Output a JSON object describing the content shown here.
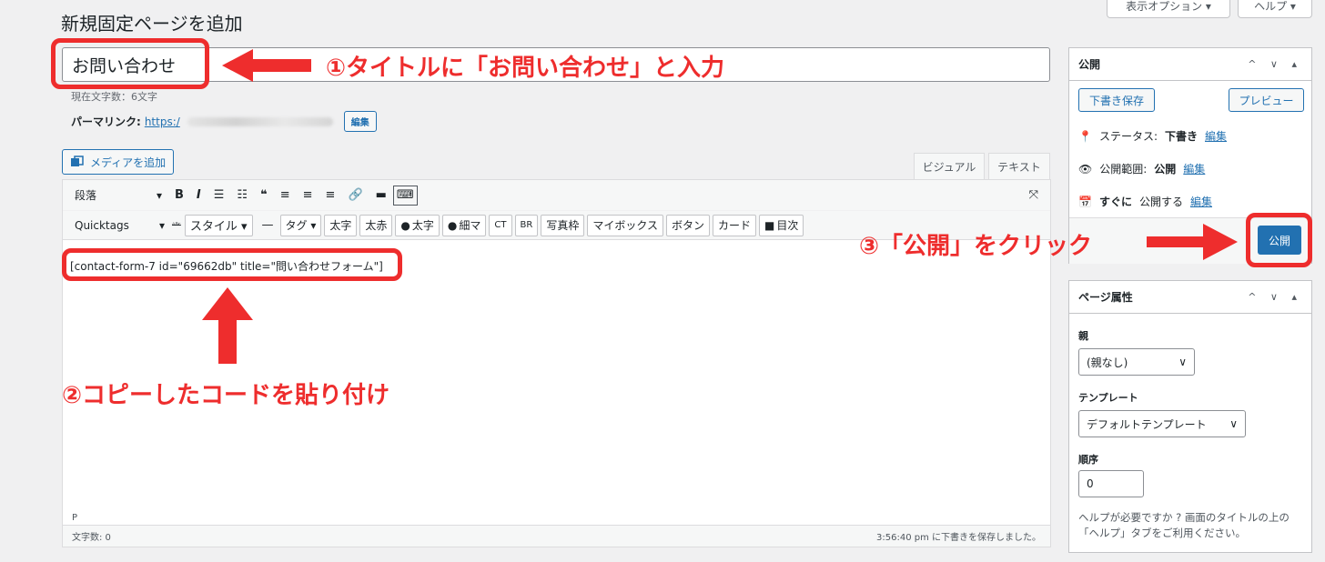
{
  "screen_options": {
    "display_options": "表示オプション ▾",
    "help": "ヘルプ ▾"
  },
  "page": {
    "title": "新規固定ページを追加",
    "post_title": "お問い合わせ",
    "char_count": "現在文字数：6文字",
    "permalink_label": "パーマリンク:",
    "permalink_url": "https:/",
    "edit_label": "編集"
  },
  "editor": {
    "add_media": "メディアを追加",
    "tab_visual": "ビジュアル",
    "tab_text": "テキスト",
    "format_select": "段落",
    "toolbar1": [
      "B",
      "I",
      "☰",
      "☷",
      "❝",
      "≡",
      "≡",
      "≡",
      "🔗",
      "▬",
      "⌨"
    ],
    "quicktags": "Quicktags",
    "toolbar2": [
      "ᴬᴮᶜ",
      "スタイル ▾",
      "—",
      "タグ ▾",
      "太字",
      "太赤",
      "太字",
      "細マ",
      "CT",
      "BR",
      "写真枠",
      "マイボックス",
      "ボタン",
      "カード",
      "目次"
    ],
    "content": "[contact-form-7 id=\"69662db\" title=\"問い合わせフォーム\"]",
    "status_path": "P",
    "word_count": "文字数: 0",
    "saved_at": "3:56:40 pm に下書きを保存しました。"
  },
  "publish_box": {
    "heading": "公開",
    "save_draft": "下書き保存",
    "preview": "プレビュー",
    "status_label": "ステータス:",
    "status_value": "下書き",
    "visibility_label": "公開範囲:",
    "visibility_value": "公開",
    "schedule_label": "すぐに",
    "schedule_value": "公開する",
    "edit": "編集",
    "publish": "公開"
  },
  "attributes_box": {
    "heading": "ページ属性",
    "parent_label": "親",
    "parent_value": "(親なし)",
    "template_label": "テンプレート",
    "template_value": "デフォルトテンプレート",
    "order_label": "順序",
    "order_value": "0",
    "help_text": "ヘルプが必要ですか ? 画面のタイトルの上の「ヘルプ」タブをご利用ください。"
  },
  "annotations": {
    "step1": "①タイトルに「お問い合わせ」と入力",
    "step2": "②コピーしたコードを貼り付け",
    "step3": "③「公開」をクリック"
  },
  "colors": {
    "accent": "#2271b1",
    "annotation_red": "#ee2d2d"
  }
}
